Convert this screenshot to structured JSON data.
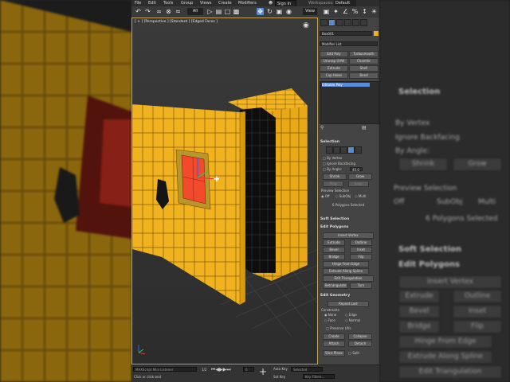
{
  "menu": [
    "File",
    "Edit",
    "Tools",
    "Group",
    "Views",
    "Create",
    "Modifiers"
  ],
  "signin": "Sign In",
  "workspaces_label": "Workspaces:",
  "workspace_value": "Default",
  "viewport_label": "[ + ] [Perspective ] [Standard ] [Edged Faces ]",
  "object_name": "Box001",
  "modifier_list": "Modifier List",
  "top_buttons": [
    "Edit Poly",
    "Turbosmooth",
    "Unwrap UVW",
    "Chamfer",
    "Extrude",
    "Shell",
    "Cap Holes",
    "Bend"
  ],
  "stack_item": "Editable Poly",
  "selection": {
    "title": "Selection",
    "by_vertex": "By Vertex",
    "ignore_backfacing": "Ignore Backfacing",
    "by_angle": "By Angle:",
    "by_angle_value": "45.0",
    "shrink": "Shrink",
    "grow": "Grow",
    "ring": "Ring",
    "loop": "Loop",
    "preview": "Preview Selection",
    "off": "Off",
    "subobj": "SubObj",
    "multi": "Multi",
    "status": "6 Polygons Selected"
  },
  "soft_selection": "Soft Selection",
  "edit_polygons": {
    "title": "Edit Polygons",
    "insert_vertex": "Insert Vertex",
    "extrude": "Extrude",
    "outline": "Outline",
    "bevel": "Bevel",
    "inset": "Inset",
    "bridge": "Bridge",
    "flip": "Flip",
    "hinge": "Hinge From Edge",
    "extrude_spline": "Extrude Along Spline",
    "edit_triangulation": "Edit Triangulation",
    "retriangulate": "Retriangulate",
    "turn": "Turn"
  },
  "edit_geometry": {
    "title": "Edit Geometry",
    "repeat_last": "Repeat Last",
    "constraints": "Constraints",
    "none": "None",
    "edge": "Edge",
    "face": "Face",
    "normal": "Normal",
    "preserve_uvs": "Preserve UVs",
    "create": "Create",
    "collapse": "Collapse",
    "attach": "Attach",
    "detach": "Detach",
    "slice_plane": "Slice Plane",
    "split": "Split"
  },
  "status": {
    "maxscript": "MAXScript Mini Listener",
    "hint": "Click or click-and",
    "frame": "1/2",
    "auto_key": "Auto Key",
    "set_key": "Set Key",
    "selected": "Selected",
    "key_filters": "Key Filters...",
    "frame_value": "0"
  },
  "colors": {
    "poly_face": "#f0b21e",
    "selected_face": "#f24a2a",
    "edges": "#6b4a0a",
    "active_blue": "#5b8bd6"
  }
}
